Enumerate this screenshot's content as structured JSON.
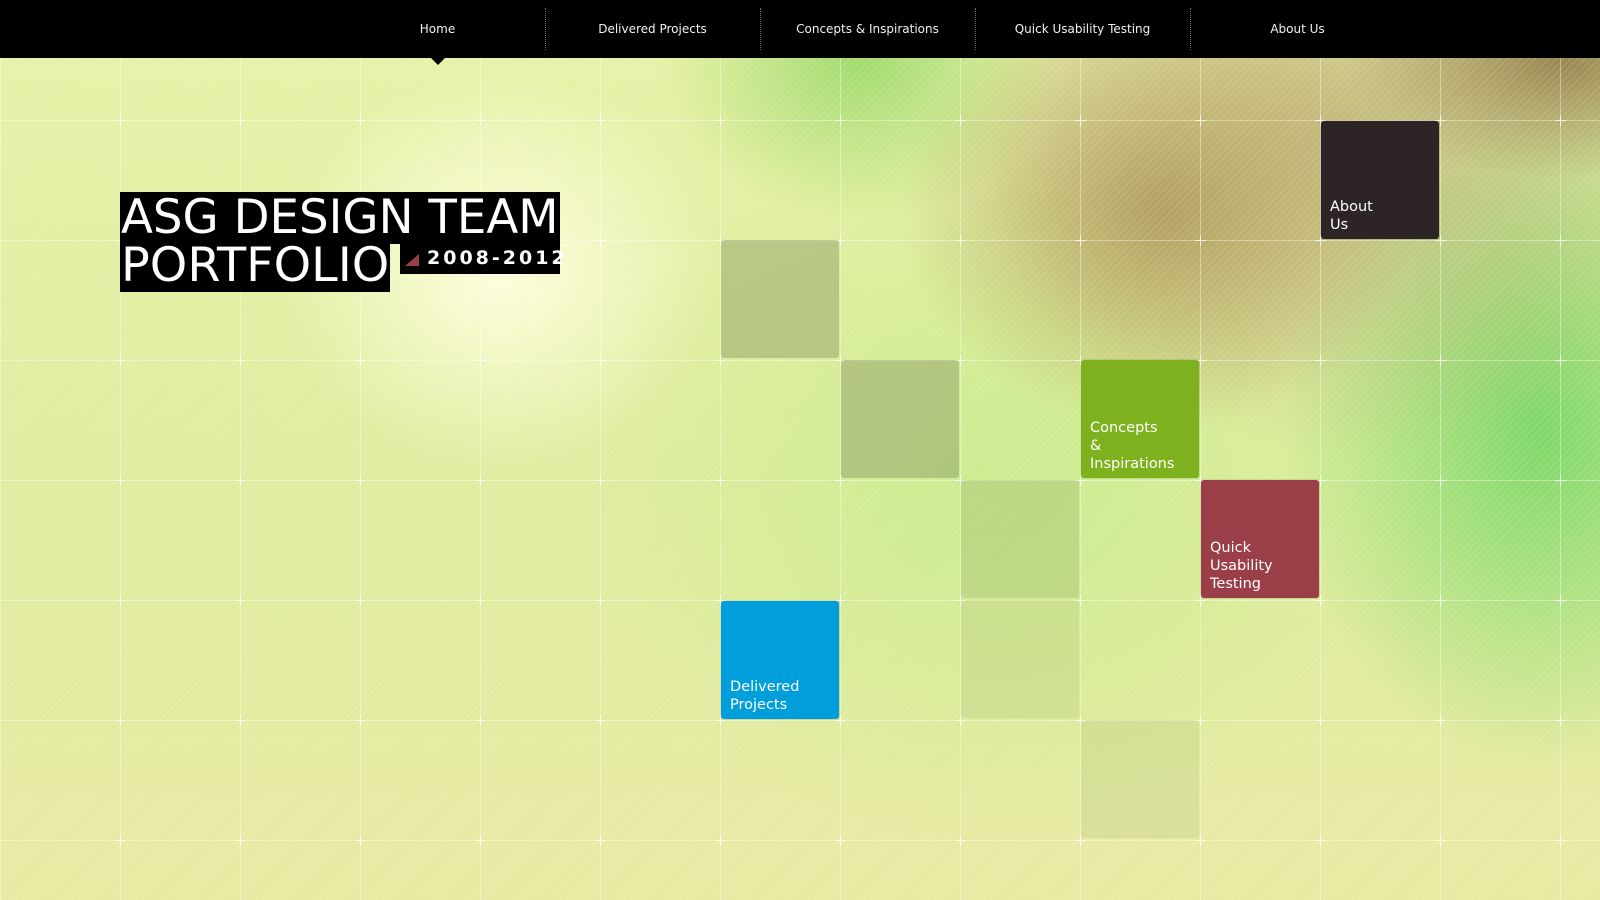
{
  "nav": {
    "items": [
      {
        "label": "Home",
        "active": true
      },
      {
        "label": "Delivered Projects",
        "active": false
      },
      {
        "label": "Concepts & Inspirations",
        "active": false
      },
      {
        "label": "Quick Usability Testing",
        "active": false
      },
      {
        "label": "About Us",
        "active": false
      }
    ]
  },
  "hero": {
    "title_line1": "ASG DESIGN TEAM",
    "title_line2": "PORTFOLIO",
    "years": "2008-2012",
    "accent_color": "#9b3e45"
  },
  "tiles": {
    "about": {
      "label": "About\nUs",
      "color": "#2e2325"
    },
    "concepts": {
      "label": "Concepts\n&\nInspirations",
      "color": "#7db21e"
    },
    "usability": {
      "label": "Quick\nUsability\nTesting",
      "color": "#9a3f47"
    },
    "delivered": {
      "label": "Delivered\nProjects",
      "color": "#009fdc"
    }
  }
}
